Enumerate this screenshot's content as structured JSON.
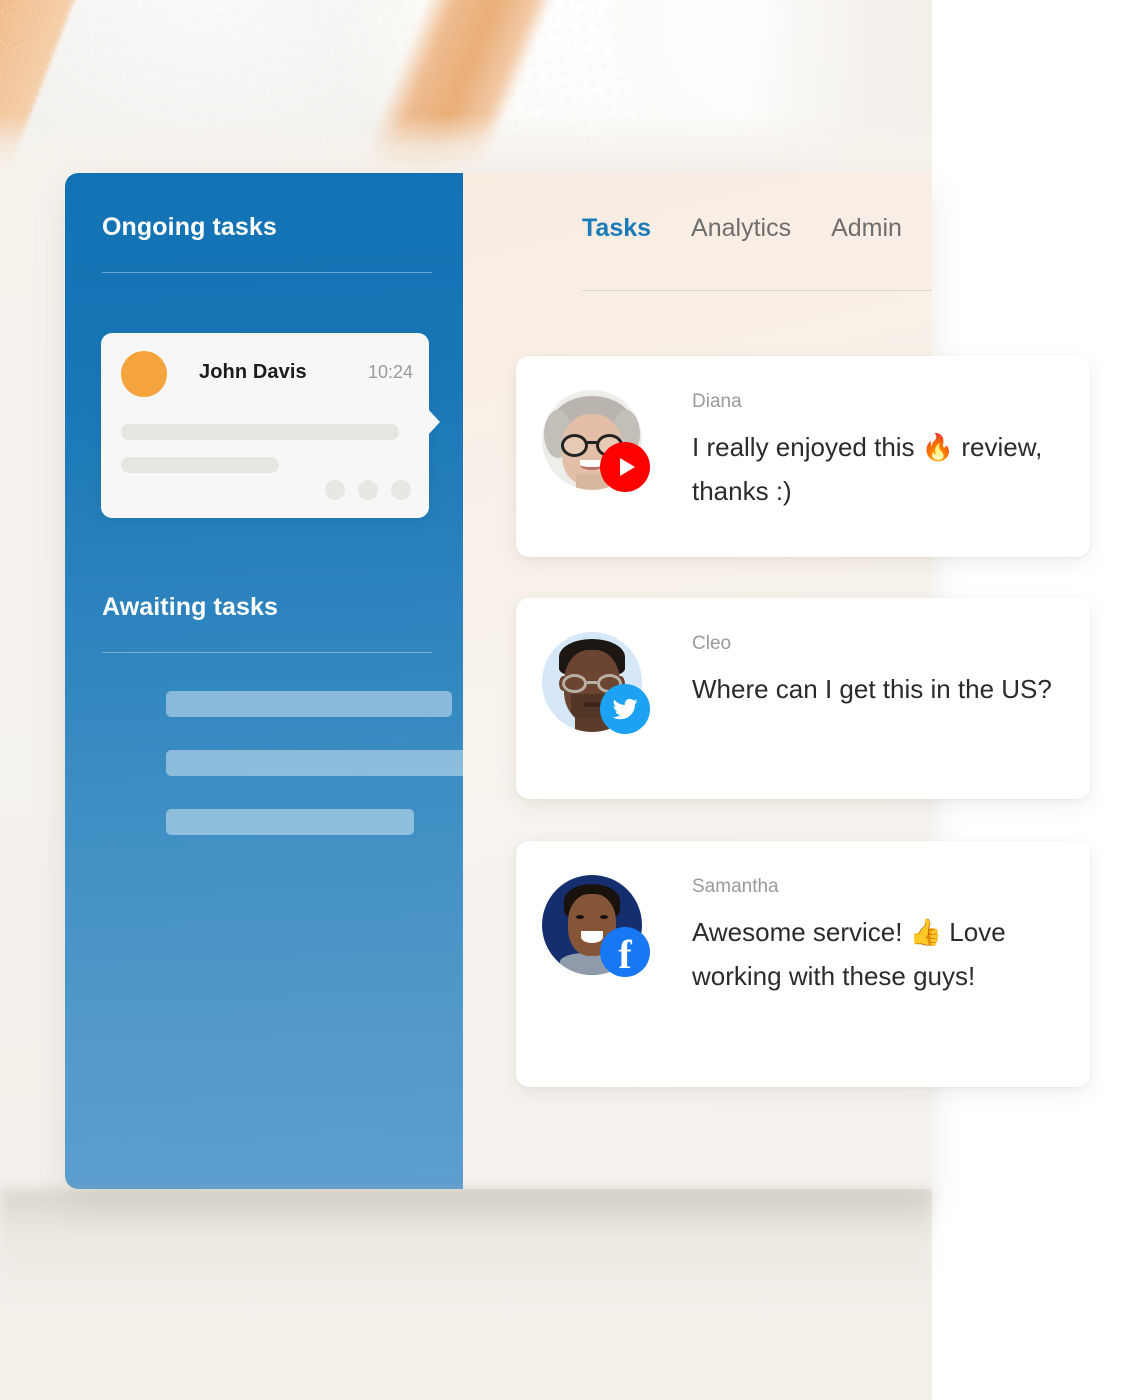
{
  "sidebar": {
    "ongoing": {
      "title": "Ongoing tasks",
      "task": {
        "name": "John Davis",
        "time": "10:24"
      }
    },
    "awaiting": {
      "title": "Awaiting tasks"
    }
  },
  "content": {
    "tabs": [
      {
        "label": "Tasks",
        "active": true
      },
      {
        "label": "Analytics",
        "active": false
      },
      {
        "label": "Admin",
        "active": false
      }
    ],
    "comments": [
      {
        "author": "Diana",
        "text": "I really enjoyed this 🔥 review, thanks :)",
        "network": "youtube-icon"
      },
      {
        "author": "Cleo",
        "text": "Where can I get this in the US?",
        "network": "twitter-icon"
      },
      {
        "author": "Samantha",
        "text": "Awesome service! 👍 Love working with these guys!",
        "network": "facebook-icon"
      }
    ]
  },
  "colors": {
    "sidebar_blue_top": "#1272b4",
    "sidebar_blue_bottom": "#5c9ed0",
    "tab_active": "#1b7ab8",
    "tab_inactive": "#6e6e6e",
    "avatar_orange": "#f5a33c",
    "youtube_red": "#ff0000",
    "twitter_blue": "#1da1f2",
    "facebook_blue": "#1877f2",
    "page_cream": "#f5f2ed"
  }
}
